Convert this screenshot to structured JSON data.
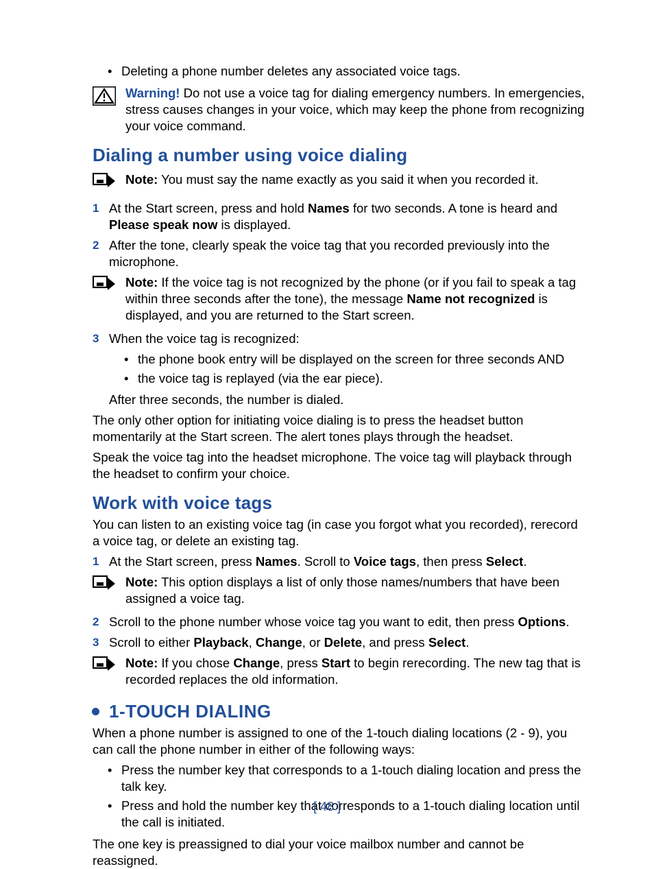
{
  "top": {
    "bullet": "Deleting a phone number deletes any associated voice tags.",
    "warning_label": "Warning!",
    "warning_text": " Do not use a voice tag for dialing emergency numbers. In emergencies, stress causes changes in your voice, which may keep the phone from recognizing your voice command."
  },
  "sec1": {
    "title": "Dialing a number using voice dialing",
    "note1_label": "Note:",
    "note1_text": " You must say the name exactly as you said it when you recorded it.",
    "step1_a": "At the Start screen, press and hold ",
    "step1_b": "Names",
    "step1_c": " for two seconds. A tone is heard and ",
    "step1_d": "Please speak now",
    "step1_e": " is displayed.",
    "step2": "After the tone, clearly speak the voice tag that you recorded previously into the microphone.",
    "note2_label": "Note:",
    "note2_a": " If the voice tag is not recognized by the phone (or if you fail to speak a tag within three seconds after the tone), the message ",
    "note2_b": "Name not recognized",
    "note2_c": " is displayed, and you are returned to the Start screen.",
    "step3_lead": "When the voice tag is recognized:",
    "step3_sub1": "the phone book entry will be displayed on the screen for three seconds AND",
    "step3_sub2": "the voice tag is replayed (via the ear piece).",
    "step3_after": "After three seconds, the number is dialed.",
    "para1": "The only other option for initiating voice dialing is to press the headset button momentarily at the Start screen. The alert tones plays through the headset.",
    "para2": "Speak the voice tag into the headset microphone. The voice tag will playback through the headset to confirm your choice."
  },
  "sec2": {
    "title": "Work with voice tags",
    "intro": "You can listen to an existing voice tag (in case you forgot what you recorded), rerecord a voice tag, or delete an existing tag.",
    "step1_a": "At the Start screen, press ",
    "step1_b": "Names",
    "step1_c": ". Scroll to ",
    "step1_d": "Voice tags",
    "step1_e": ", then press ",
    "step1_f": "Select",
    "step1_g": ".",
    "note1_label": "Note:",
    "note1_text": " This option displays a list of only those names/numbers that have been assigned a voice tag.",
    "step2_a": "Scroll to the phone number whose voice tag you want to edit, then press ",
    "step2_b": "Options",
    "step2_c": ".",
    "step3_a": "Scroll to either ",
    "step3_b": "Playback",
    "step3_c": ", ",
    "step3_d": "Change",
    "step3_e": ", or ",
    "step3_f": "Delete",
    "step3_g": ", and press ",
    "step3_h": "Select",
    "step3_i": ".",
    "note2_label": "Note:",
    "note2_a": " If you chose ",
    "note2_b": "Change",
    "note2_c": ", press ",
    "note2_d": "Start",
    "note2_e": " to begin rerecording. The new tag that is recorded replaces the old information."
  },
  "sec3": {
    "title": "1-TOUCH DIALING",
    "intro": "When a phone number is assigned to one of the 1-touch dialing locations (2 - 9), you can call the phone number in either of the following ways:",
    "b1": "Press the number key that corresponds to a 1-touch dialing location and press the talk key.",
    "b2": "Press and hold the number key that corresponds to a 1-touch dialing location until the call is initiated.",
    "outro": "The one key is preassigned to dial your voice mailbox number and cannot be reassigned."
  },
  "page_number": "[ 48 ]"
}
